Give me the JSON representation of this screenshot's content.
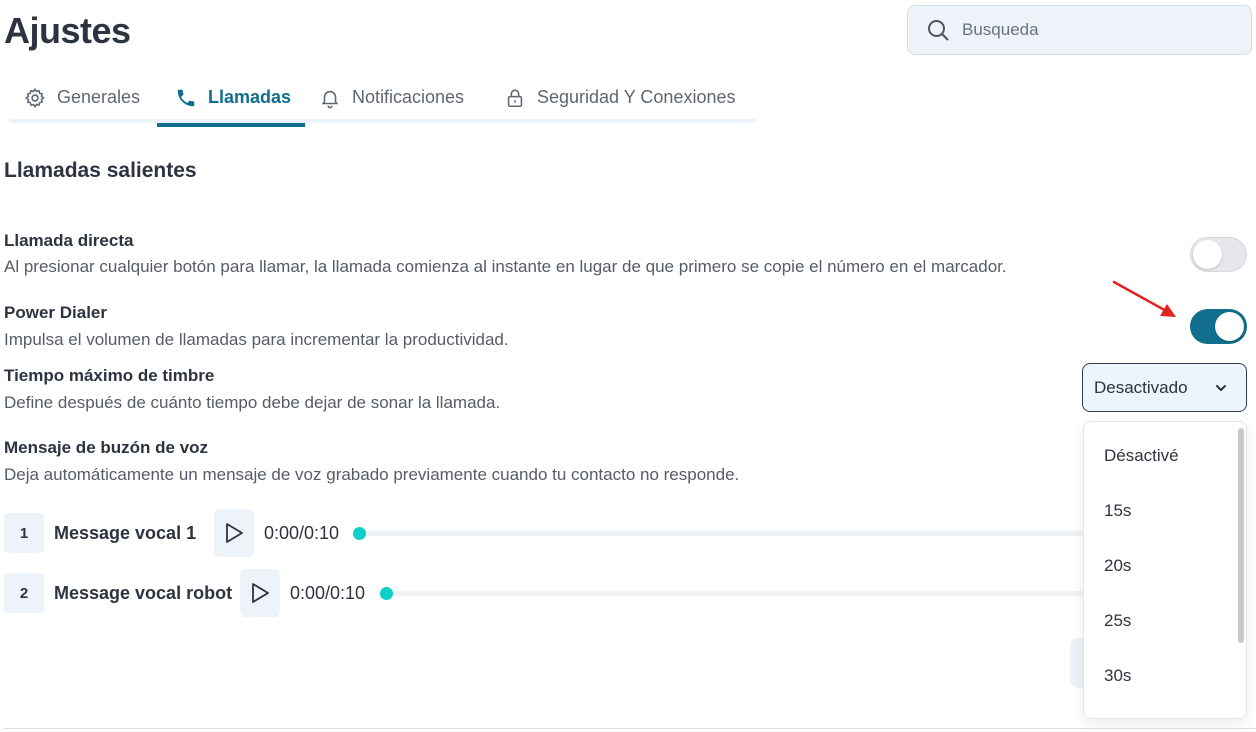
{
  "page": {
    "title": "Ajustes"
  },
  "search": {
    "placeholder": "Busqueda"
  },
  "tabs": [
    {
      "label": "Generales",
      "icon": "gear-icon",
      "active": false
    },
    {
      "label": "Llamadas",
      "icon": "phone-icon",
      "active": true
    },
    {
      "label": "Notificaciones",
      "icon": "bell-icon",
      "active": false
    },
    {
      "label": "Seguridad Y Conexiones",
      "icon": "lock-icon",
      "active": false
    }
  ],
  "section": {
    "title": "Llamadas salientes"
  },
  "settings": {
    "direct_call": {
      "title": "Llamada directa",
      "description": "Al presionar cualquier botón para llamar, la llamada comienza al instante en lugar de que primero se copie el número en el marcador.",
      "enabled": false
    },
    "power_dialer": {
      "title": "Power Dialer",
      "description": "Impulsa el volumen de llamadas para incrementar la productividad.",
      "enabled": true
    },
    "ring_time": {
      "title": "Tiempo máximo de timbre",
      "description": "Define después de cuánto tiempo debe dejar de sonar la llamada.",
      "selected": "Desactivado",
      "options": [
        "Désactivé",
        "15s",
        "20s",
        "25s",
        "30s"
      ]
    },
    "voicemail": {
      "title": "Mensaje de buzón de voz",
      "description": "Deja automáticamente un mensaje de voz grabado previamente cuando tu contacto no responde.",
      "messages": [
        {
          "number": "1",
          "name": "Message vocal 1",
          "time": "0:00/0:10",
          "progress": 0
        },
        {
          "number": "2",
          "name": "Message vocal robot",
          "time": "0:00/0:10",
          "progress": 0
        }
      ]
    }
  },
  "colors": {
    "accent": "#0f6f8c",
    "progress_dot": "#0fd0c7",
    "annotation_arrow": "#e02424"
  }
}
